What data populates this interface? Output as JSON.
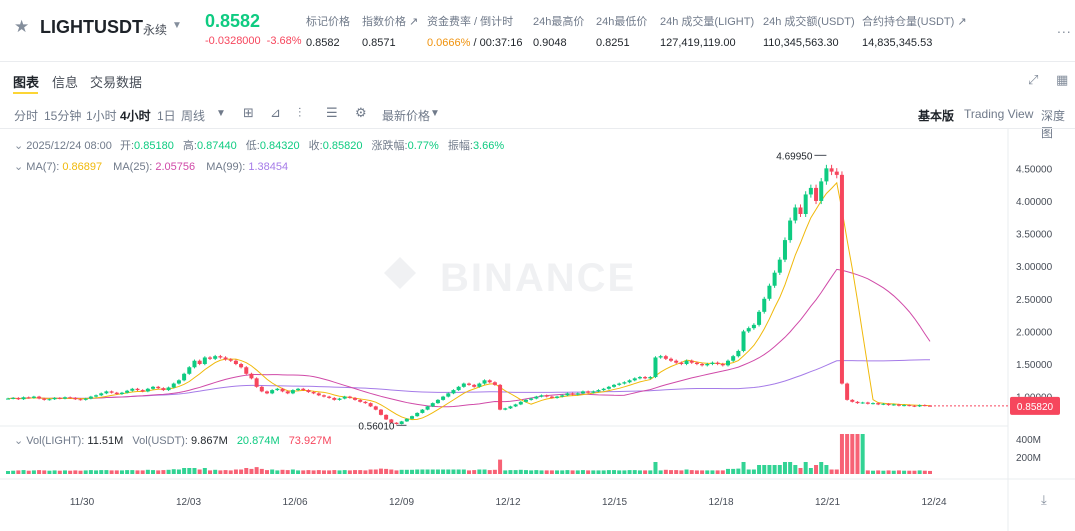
{
  "header": {
    "symbol": "LIGHTUSDT",
    "contract_type": "永续",
    "last_price": "0.8582",
    "change_abs": "-0.0328000",
    "change_pct": "-3.68%",
    "stats": [
      {
        "label": "标记价格",
        "value": "0.8582"
      },
      {
        "label": "指数价格 ↗",
        "value": "0.8571"
      },
      {
        "label": "资金费率 / 倒计时",
        "value": "0.0666%",
        "value2": "/ 00:37:16"
      },
      {
        "label": "24h最高价",
        "value": "0.9048"
      },
      {
        "label": "24h最低价",
        "value": "0.8251"
      },
      {
        "label": "24h 成交量(LIGHT)",
        "value": "127,419,119.00"
      },
      {
        "label": "24h 成交额(USDT)",
        "value": "110,345,563.30"
      },
      {
        "label": "合约持仓量(USDT) ↗",
        "value": "14,835,345.53"
      }
    ],
    "more": "..."
  },
  "tabs": [
    "图表",
    "信息",
    "交易数据"
  ],
  "toolbar": {
    "intervals": [
      "分时",
      "15分钟",
      "1小时",
      "4小时",
      "1日",
      "周线"
    ],
    "active_interval": "4小时",
    "price_type": "最新价格",
    "views": [
      "基本版",
      "Trading View",
      "深度图"
    ],
    "active_view": "基本版"
  },
  "ohlc": {
    "date": "2025/12/24 08:00",
    "open_label": "开:",
    "open": "0.85180",
    "high_label": "高:",
    "high": "0.87440",
    "low_label": "低:",
    "low": "0.84320",
    "close_label": "收:",
    "close": "0.85820",
    "chg_label": "涨跌幅:",
    "chg": "0.77%",
    "amp_label": "振幅:",
    "amp": "3.66%"
  },
  "ma": {
    "ma7_label": "MA(7):",
    "ma7": "0.86897",
    "ma25_label": "MA(25):",
    "ma25": "2.05756",
    "ma99_label": "MA(99):",
    "ma99": "1.38454"
  },
  "volume": {
    "label1": "Vol(LIGHT):",
    "v1": "11.51M",
    "label2": "Vol(USDT):",
    "v2": "9.867M",
    "v3": "20.874M",
    "v4": "73.927M"
  },
  "watermark": "BINANCE",
  "colors": {
    "up": "#0ecb81",
    "down": "#f6465d",
    "ma7": "#f0b90b",
    "ma25": "#d04aa8",
    "ma99": "#a57be8"
  },
  "chart_data": {
    "type": "candlestick",
    "y_axis_ticks": [
      4.5,
      4.0,
      3.5,
      3.0,
      2.5,
      2.0,
      1.5,
      1.0
    ],
    "y_axis_labels": [
      "4.50000",
      "4.00000",
      "3.50000",
      "3.00000",
      "2.50000",
      "2.00000",
      "1.50000",
      "1.00000"
    ],
    "ylim": [
      0.35,
      4.95
    ],
    "x_labels": [
      "11/30",
      "12/03",
      "12/06",
      "12/09",
      "12/12",
      "12/15",
      "12/18",
      "12/21",
      "12/24"
    ],
    "current_price_label": "0.85820",
    "high_annotation": "4.69950",
    "low_annotation": "0.56010",
    "vol_axis_labels": [
      "400M",
      "200M"
    ],
    "closes": [
      0.97,
      0.98,
      0.96,
      0.99,
      0.98,
      1.0,
      0.97,
      0.95,
      0.96,
      0.98,
      0.97,
      0.99,
      0.98,
      0.96,
      0.95,
      0.97,
      1.0,
      1.02,
      1.05,
      1.08,
      1.06,
      1.04,
      1.06,
      1.09,
      1.12,
      1.1,
      1.08,
      1.12,
      1.15,
      1.13,
      1.1,
      1.14,
      1.2,
      1.25,
      1.35,
      1.45,
      1.55,
      1.5,
      1.6,
      1.58,
      1.62,
      1.6,
      1.57,
      1.55,
      1.5,
      1.45,
      1.35,
      1.28,
      1.15,
      1.08,
      1.05,
      1.1,
      1.12,
      1.08,
      1.05,
      1.1,
      1.12,
      1.1,
      1.07,
      1.05,
      1.02,
      1.0,
      0.98,
      0.95,
      0.97,
      1.0,
      0.98,
      0.95,
      0.92,
      0.9,
      0.85,
      0.8,
      0.72,
      0.65,
      0.6,
      0.58,
      0.62,
      0.66,
      0.7,
      0.75,
      0.8,
      0.85,
      0.9,
      0.95,
      1.0,
      1.05,
      1.1,
      1.15,
      1.2,
      1.18,
      1.15,
      1.2,
      1.25,
      1.22,
      1.18,
      0.8,
      0.82,
      0.85,
      0.88,
      0.92,
      0.95,
      0.97,
      1.0,
      1.02,
      1.0,
      0.98,
      1.0,
      1.02,
      1.05,
      1.03,
      1.05,
      1.08,
      1.06,
      1.08,
      1.1,
      1.12,
      1.15,
      1.18,
      1.2,
      1.22,
      1.25,
      1.28,
      1.3,
      1.28,
      1.3,
      1.6,
      1.62,
      1.58,
      1.55,
      1.52,
      1.5,
      1.55,
      1.52,
      1.5,
      1.48,
      1.5,
      1.52,
      1.5,
      1.48,
      1.55,
      1.62,
      1.7,
      2.0,
      2.05,
      2.1,
      2.3,
      2.5,
      2.7,
      2.9,
      3.1,
      3.4,
      3.7,
      3.9,
      3.8,
      4.1,
      4.2,
      4.0,
      4.3,
      4.5,
      4.45,
      4.4,
      1.2,
      0.95,
      0.92,
      0.9,
      0.91,
      0.89,
      0.9,
      0.88,
      0.89,
      0.87,
      0.88,
      0.86,
      0.87,
      0.86,
      0.85,
      0.87,
      0.86,
      0.858
    ]
  }
}
